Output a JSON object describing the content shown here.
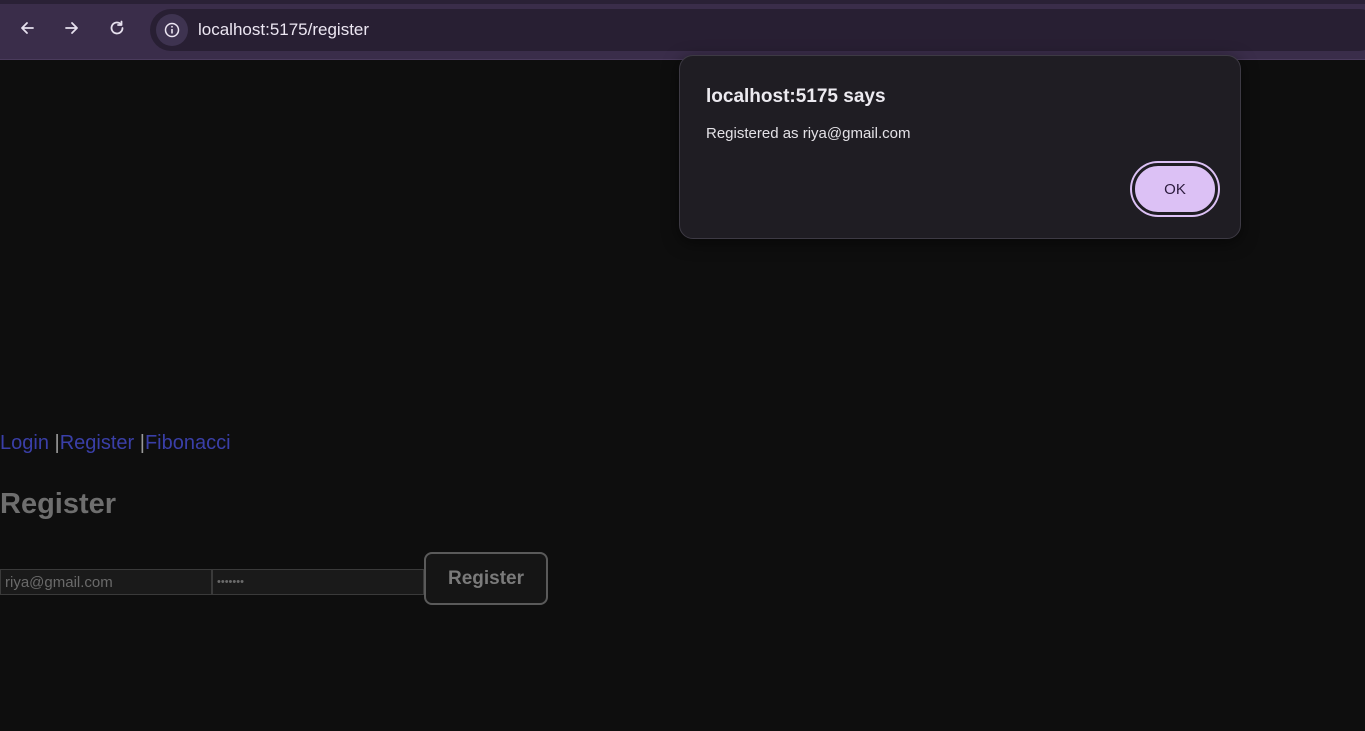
{
  "browser": {
    "url": "localhost:5175/register",
    "back_icon": "arrow-left-icon",
    "forward_icon": "arrow-right-icon",
    "reload_icon": "reload-icon",
    "info_icon": "info-icon"
  },
  "nav": {
    "login": "Login",
    "sep1": "|",
    "register": "Register",
    "sep2": "|",
    "fibonacci": "Fibonacci"
  },
  "page": {
    "title": "Register",
    "email_value": "riya@gmail.com",
    "password_value": "•••••••",
    "submit_label": "Register"
  },
  "dialog": {
    "title": "localhost:5175 says",
    "message": "Registered as riya@gmail.com",
    "ok_label": "OK",
    "accent": "#dcc1f5"
  }
}
